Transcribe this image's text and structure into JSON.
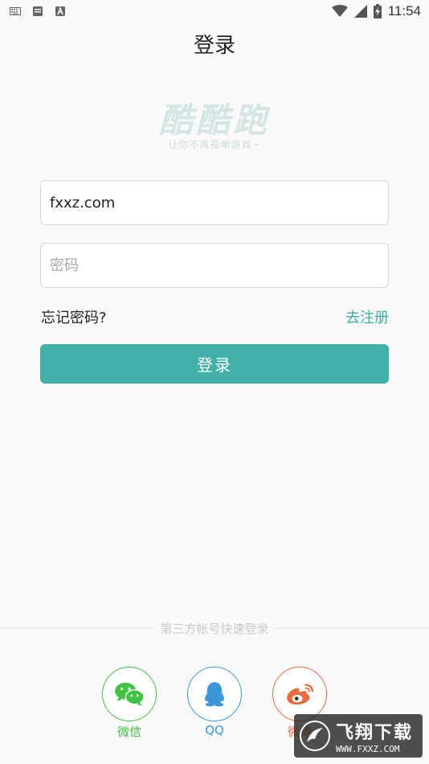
{
  "status_bar": {
    "time": "11:54",
    "icons": [
      "keyboard-icon",
      "mail-icon",
      "font-icon",
      "wifi-icon",
      "signal-icon",
      "battery-charging-icon"
    ]
  },
  "header": {
    "title": "登录"
  },
  "logo": {
    "text": "酷酷跑",
    "slogan": "让你不再孤单游戏~"
  },
  "form": {
    "username_value": "fxxz.com",
    "username_placeholder": "",
    "password_placeholder": "密码",
    "forgot_label": "忘记密码?",
    "register_label": "去注册",
    "login_label": "登录"
  },
  "third_party": {
    "label": "第三方帐号快速登录",
    "items": [
      {
        "label": "微信",
        "icon": "wechat-icon",
        "color": "#3fc341"
      },
      {
        "label": "QQ",
        "icon": "qq-icon",
        "color": "#3b97d8"
      },
      {
        "label": "微博",
        "icon": "weibo-icon",
        "color": "#ea6a3a"
      }
    ]
  },
  "watermark": {
    "text": "飞翔下载",
    "url": "WWW.FXXZ.COM"
  },
  "colors": {
    "accent": "#40b0a8",
    "link": "#3aafa6"
  }
}
